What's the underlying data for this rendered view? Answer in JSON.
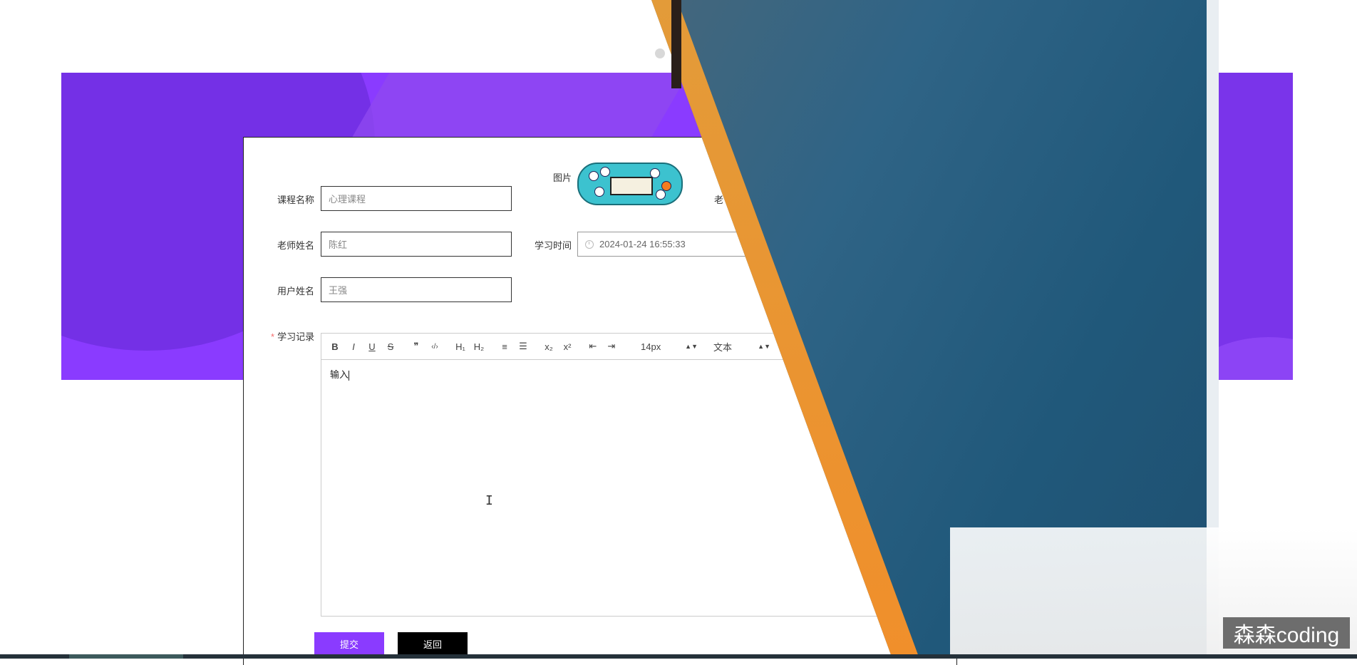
{
  "carousel": {
    "dots": 2,
    "active_index": 1
  },
  "form": {
    "course_name": {
      "label": "课程名称",
      "value": "心理课程"
    },
    "image": {
      "label": "图片"
    },
    "teacher_name": {
      "label": "老师姓名",
      "value": "陈红"
    },
    "study_time": {
      "label": "学习时间",
      "value": "2024-01-24 16:55:33"
    },
    "user_name": {
      "label": "用户姓名",
      "value": "王强"
    },
    "cut_label": "老",
    "study_record": {
      "label": "学习记录",
      "required_mark": "*",
      "content": "输入",
      "toolbar": {
        "bold": "B",
        "italic": "I",
        "underline": "U",
        "strike": "S",
        "quote": "❞",
        "code": "‹/›",
        "h1": "H₁",
        "h2": "H₂",
        "ordered_list": "≡",
        "bullet_list": "☰",
        "subscript": "x₂",
        "superscript": "x²",
        "outdent": "⇤",
        "indent": "⇥",
        "font_size": "14px",
        "text_type": "文本"
      }
    },
    "buttons": {
      "submit": "提交",
      "back": "返回"
    }
  },
  "watermark": "森森coding",
  "colors": {
    "primary": "#8a3bff",
    "banner_dark": "#7430e6",
    "back_button": "#000000",
    "required": "#f56c6c"
  }
}
